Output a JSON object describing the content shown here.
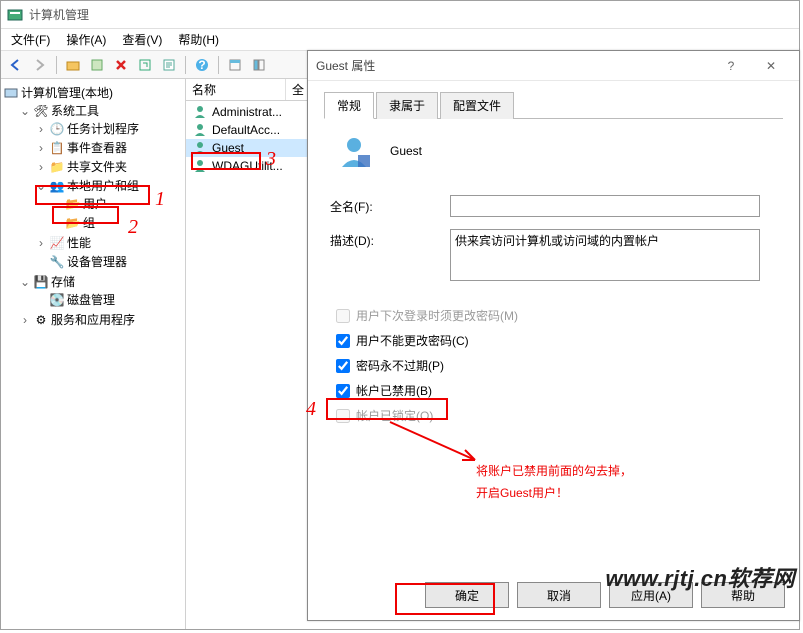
{
  "app": {
    "title": "计算机管理"
  },
  "menu": {
    "file": "文件(F)",
    "action": "操作(A)",
    "view": "查看(V)",
    "help": "帮助(H)"
  },
  "tree": {
    "root": "计算机管理(本地)",
    "system_tools": "系统工具",
    "task_scheduler": "任务计划程序",
    "event_viewer": "事件查看器",
    "shared_folders": "共享文件夹",
    "local_users": "本地用户和组",
    "users": "用户",
    "groups": "组",
    "performance": "性能",
    "device_mgr": "设备管理器",
    "storage": "存储",
    "disk_mgmt": "磁盘管理",
    "services_apps": "服务和应用程序"
  },
  "list": {
    "header_name": "名称",
    "header_full": "全",
    "rows": [
      "Administrat...",
      "DefaultAcc...",
      "Guest",
      "WDAGUtilit..."
    ]
  },
  "dialog": {
    "title": "Guest 属性",
    "tabs": {
      "general": "常规",
      "memberof": "隶属于",
      "profile": "配置文件"
    },
    "account_name": "Guest",
    "fullname_label": "全名(F):",
    "fullname_value": "",
    "desc_label": "描述(D):",
    "desc_value": "供来宾访问计算机或访问域的内置帐户",
    "chk_mustchange": "用户下次登录时须更改密码(M)",
    "chk_cannotchange": "用户不能更改密码(C)",
    "chk_neverexpire": "密码永不过期(P)",
    "chk_disabled": "帐户已禁用(B)",
    "chk_locked": "帐户已锁定(O)",
    "btn_ok": "确定",
    "btn_cancel": "取消",
    "btn_apply": "应用(A)",
    "btn_help": "帮助"
  },
  "annotations": {
    "n1": "1",
    "n2": "2",
    "n3": "3",
    "n4": "4",
    "note1": "将账户已禁用前面的勾去掉，",
    "note2": "开启Guest用户！",
    "watermark": "www.rjtj.cn软荐网"
  }
}
